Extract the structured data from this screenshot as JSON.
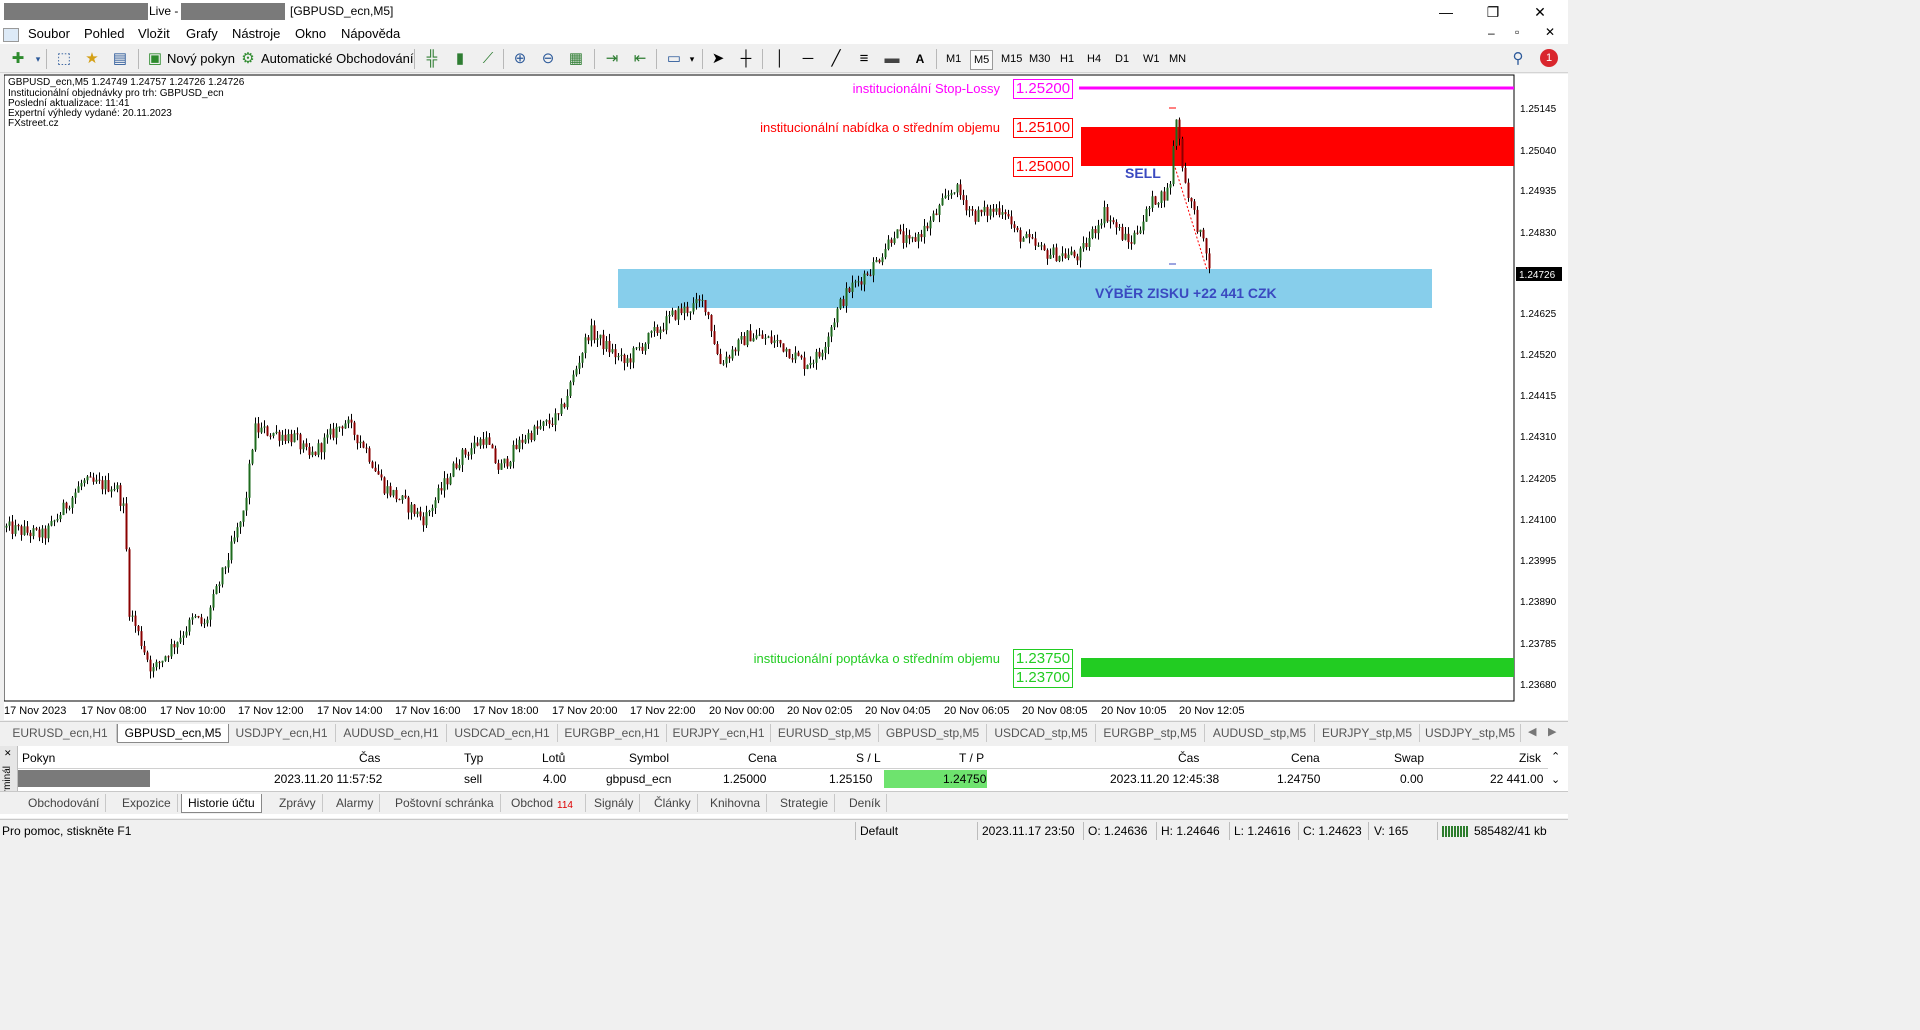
{
  "window": {
    "live_label": "Live -",
    "title": "[GBPUSD_ecn,M5]",
    "minimize": "—",
    "maximize": "❐",
    "close": "✕"
  },
  "menu": [
    "Soubor",
    "Pohled",
    "Vložit",
    "Grafy",
    "Nástroje",
    "Okno",
    "Nápověda"
  ],
  "toolbar": {
    "new_order": "Nový pokyn",
    "auto_trading": "Automatické Obchodování",
    "timeframes": [
      "M1",
      "M5",
      "M15",
      "M30",
      "H1",
      "H4",
      "D1",
      "W1",
      "MN"
    ],
    "active_timeframe": "M5",
    "notification_count": "1",
    "text_tool": "A"
  },
  "chart_info": [
    "GBPUSD_ecn,M5  1.24749 1.24757 1.24726 1.24726",
    "Institucionální objednávky pro trh: GBPUSD_ecn",
    "Poslední aktualizace: 11:41",
    "Expertní výhledy vydané: 20.11.2023",
    "FXstreet.cz"
  ],
  "zones": {
    "stop_loss_label": "institucionální Stop-Lossy",
    "stop_loss_price": "1.25200",
    "offer_label": "institucionální nabídka o středním objemu",
    "offer_price_top": "1.25100",
    "offer_price_bottom": "1.25000",
    "bid_label": "institucionální poptávka o středním objemu",
    "bid_price_top": "1.23750",
    "bid_price_bottom": "1.23700",
    "sell_label": "SELL",
    "profit_label": "VÝBĚR ZISKU +22 441 CZK",
    "colors": {
      "stop_loss": "#ff00ff",
      "offer": "#ff0000",
      "bid": "#22cc22",
      "profit_zone": "#87ceeb",
      "profit_text": "#3a49c0"
    }
  },
  "chart_data": {
    "type": "candlestick",
    "symbol": "GBPUSD_ecn",
    "timeframe": "M5",
    "ylim": [
      1.2366,
      1.2518
    ],
    "current_price": "1.24726",
    "y_ticks": [
      "1.25145",
      "1.25040",
      "1.24935",
      "1.24830",
      "1.24725",
      "1.24625",
      "1.24520",
      "1.24415",
      "1.24310",
      "1.24205",
      "1.24100",
      "1.23995",
      "1.23890",
      "1.23785",
      "1.23680"
    ],
    "x_ticks": [
      "17 Nov 2023",
      "17 Nov 08:00",
      "17 Nov 10:00",
      "17 Nov 12:00",
      "17 Nov 14:00",
      "17 Nov 16:00",
      "17 Nov 18:00",
      "17 Nov 20:00",
      "17 Nov 22:00",
      "20 Nov 00:00",
      "20 Nov 02:05",
      "20 Nov 04:05",
      "20 Nov 06:05",
      "20 Nov 08:05",
      "20 Nov 10:05",
      "20 Nov 12:05"
    ],
    "anchors": [
      [
        0,
        1.2408
      ],
      [
        40,
        1.2406
      ],
      [
        78,
        1.2419
      ],
      [
        112,
        1.2418
      ],
      [
        120,
        1.2412
      ],
      [
        125,
        1.2388
      ],
      [
        148,
        1.2373
      ],
      [
        190,
        1.2386
      ],
      [
        200,
        1.2384
      ],
      [
        240,
        1.2412
      ],
      [
        250,
        1.2432
      ],
      [
        290,
        1.243
      ],
      [
        305,
        1.2425
      ],
      [
        340,
        1.2434
      ],
      [
        360,
        1.2428
      ],
      [
        380,
        1.2418
      ],
      [
        420,
        1.241
      ],
      [
        455,
        1.2425
      ],
      [
        480,
        1.243
      ],
      [
        495,
        1.2422
      ],
      [
        520,
        1.243
      ],
      [
        555,
        1.2435
      ],
      [
        585,
        1.2456
      ],
      [
        620,
        1.2448
      ],
      [
        640,
        1.2453
      ],
      [
        670,
        1.246
      ],
      [
        700,
        1.2463
      ],
      [
        705,
        1.2459
      ],
      [
        715,
        1.2448
      ],
      [
        745,
        1.2455
      ],
      [
        775,
        1.2453
      ],
      [
        800,
        1.2448
      ],
      [
        815,
        1.245
      ],
      [
        835,
        1.2462
      ],
      [
        845,
        1.2466
      ],
      [
        870,
        1.2472
      ],
      [
        890,
        1.248
      ],
      [
        905,
        1.2477
      ],
      [
        925,
        1.2482
      ],
      [
        950,
        1.2491
      ],
      [
        970,
        1.2484
      ],
      [
        1000,
        1.2486
      ],
      [
        1010,
        1.248
      ],
      [
        1040,
        1.2475
      ],
      [
        1075,
        1.2474
      ],
      [
        1100,
        1.2485
      ],
      [
        1125,
        1.2477
      ],
      [
        1150,
        1.2488
      ],
      [
        1165,
        1.249
      ],
      [
        1172,
        1.2508
      ],
      [
        1180,
        1.2493
      ],
      [
        1195,
        1.248
      ],
      [
        1205,
        1.2472
      ]
    ]
  },
  "symbol_tabs": [
    "EURUSD_ecn,H1",
    "GBPUSD_ecn,M5",
    "USDJPY_ecn,H1",
    "AUDUSD_ecn,H1",
    "USDCAD_ecn,H1",
    "EURGBP_ecn,H1",
    "EURJPY_ecn,H1",
    "EURUSD_stp,M5",
    "GBPUSD_stp,M5",
    "USDCAD_stp,M5",
    "EURGBP_stp,M5",
    "AUDUSD_stp,M5",
    "EURJPY_stp,M5",
    "USDJPY_stp,M5"
  ],
  "active_symbol_tab": "GBPUSD_ecn,M5",
  "terminal": {
    "side_label": "Terminál",
    "headers": {
      "order": "Pokyn",
      "time": "Čas",
      "type": "Typ",
      "lots": "Lotů",
      "symbol": "Symbol",
      "price": "Cena",
      "sl": "S / L",
      "tp": "T / P",
      "close_time": "Čas",
      "close_price": "Cena",
      "swap": "Swap",
      "profit": "Zisk"
    },
    "row": {
      "time": "2023.11.20 11:57:52",
      "type": "sell",
      "lots": "4.00",
      "symbol": "gbpusd_ecn",
      "price": "1.25000",
      "sl": "1.25150",
      "tp": "1.24750",
      "close_time": "2023.11.20 12:45:38",
      "close_price": "1.24750",
      "swap": "0.00",
      "profit": "22 441.00"
    },
    "tabs": [
      "Obchodování",
      "Expozice",
      "Historie účtu",
      "Zprávy",
      "Alarmy",
      "Poštovní schránka",
      "Obchod",
      "Signály",
      "Články",
      "Knihovna",
      "Strategie",
      "Deník"
    ],
    "active_tab": "Historie účtu",
    "obchod_badge": "114"
  },
  "status": {
    "help": "Pro pomoc, stiskněte F1",
    "profile": "Default",
    "datetime": "2023.11.17 23:50",
    "open": "O: 1.24636",
    "high": "H: 1.24646",
    "low": "L: 1.24616",
    "close": "C: 1.24623",
    "volume": "V: 165",
    "traffic": "585482/41 kb"
  }
}
